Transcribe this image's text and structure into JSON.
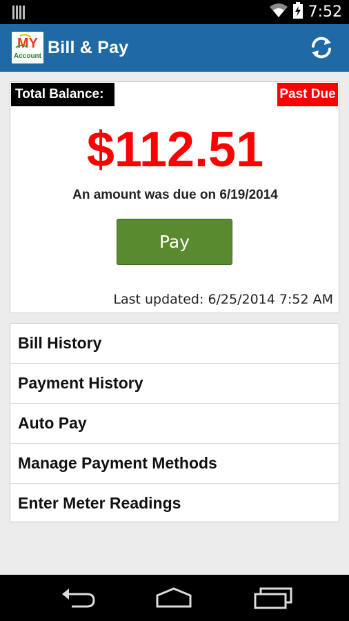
{
  "status_bar": {
    "time": "7:52",
    "icons": [
      "sim-card-icon",
      "wifi-icon",
      "battery-charging-icon"
    ]
  },
  "action_bar": {
    "logo_text_top": "MY",
    "logo_text_bottom": "Account",
    "title": "Bill & Pay",
    "refresh_icon": "refresh-icon"
  },
  "balance": {
    "label": "Total Balance:",
    "status_badge": "Past Due",
    "amount": "$112.51",
    "due_note": "An amount was due on 6/19/2014",
    "pay_label": "Pay",
    "last_updated": "Last updated:  6/25/2014 7:52 AM"
  },
  "menu": {
    "items": [
      {
        "label": "Bill History"
      },
      {
        "label": "Payment History"
      },
      {
        "label": "Auto Pay"
      },
      {
        "label": "Manage Payment Methods"
      },
      {
        "label": "Enter Meter Readings"
      }
    ]
  },
  "nav_bar": {
    "icons": [
      "back-icon",
      "home-icon",
      "recents-icon"
    ]
  },
  "colors": {
    "action_bar": "#1f6aa5",
    "past_due": "#ff0000",
    "amount": "#ff0000",
    "pay_button": "#5a8a2f"
  }
}
